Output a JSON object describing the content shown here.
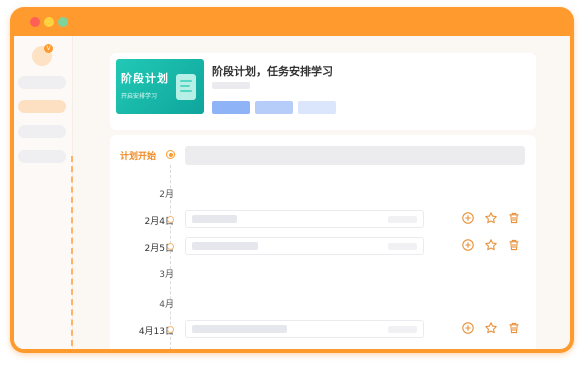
{
  "window": {
    "controls": [
      "close",
      "minimize",
      "maximize"
    ]
  },
  "sidebar": {
    "avatar_badge": "V",
    "items": [
      {
        "state": "normal"
      },
      {
        "state": "active"
      },
      {
        "state": "normal"
      },
      {
        "state": "normal"
      }
    ]
  },
  "course": {
    "banner_title": "阶段计划",
    "banner_subtitle": "开启安排学习",
    "title": "阶段计划，任务安排学习",
    "tags": [
      {
        "color": "#8fb3f7"
      },
      {
        "color": "#b6cdf9"
      },
      {
        "color": "#dbe6fc"
      }
    ]
  },
  "timeline": {
    "start_label": "计划开始",
    "entries": [
      {
        "kind": "month",
        "label": "2月"
      },
      {
        "kind": "date",
        "label": "2月4日"
      },
      {
        "kind": "date",
        "label": "2月5日"
      },
      {
        "kind": "month",
        "label": "3月"
      },
      {
        "kind": "month",
        "label": "4月"
      },
      {
        "kind": "date",
        "label": "4月13日"
      }
    ],
    "actions": [
      "add-icon",
      "star-icon",
      "trash-icon"
    ]
  },
  "colors": {
    "accent": "#ff9a2e",
    "accent_text": "#f08a24",
    "action_icon": "#e8913a",
    "banner": "#1bb8a8"
  }
}
